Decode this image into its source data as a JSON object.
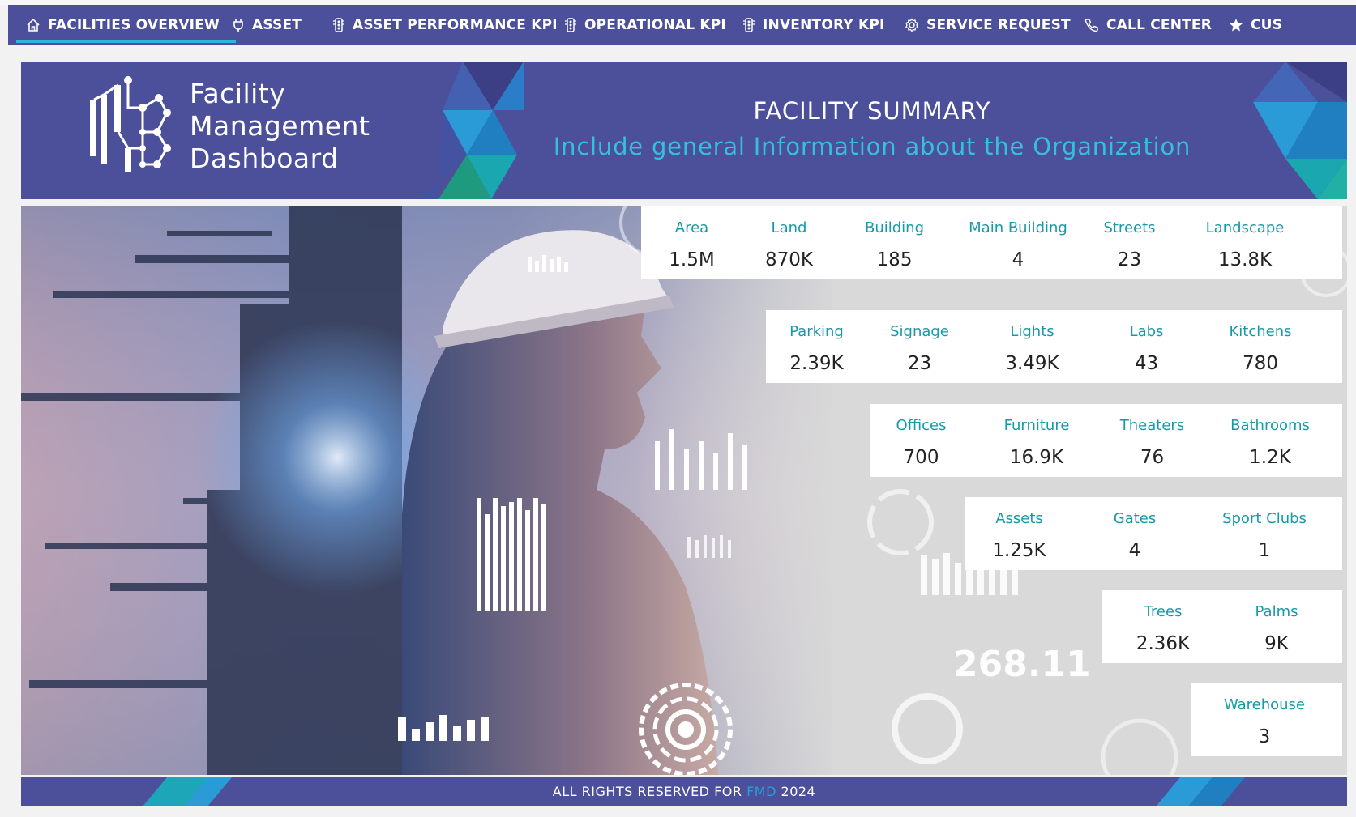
{
  "nav": {
    "items": [
      {
        "label": "FACILITIES OVERVIEW",
        "icon": "home-icon",
        "active": true
      },
      {
        "label": "ASSET",
        "icon": "plug-icon"
      },
      {
        "label": "ASSET PERFORMANCE KPI",
        "icon": "traffic-light-icon"
      },
      {
        "label": "OPERATIONAL KPI",
        "icon": "traffic-light-icon"
      },
      {
        "label": "INVENTORY KPI",
        "icon": "traffic-light-icon"
      },
      {
        "label": "SERVICE REQUEST",
        "icon": "gear-icon"
      },
      {
        "label": "CALL CENTER",
        "icon": "phone-icon"
      },
      {
        "label": "CUS",
        "icon": "star-icon"
      }
    ]
  },
  "banner": {
    "brand_line1": "Facility",
    "brand_line2": "Management",
    "brand_line3": "Dashboard",
    "title": "FACILITY SUMMARY",
    "subtitle": "Include general Information about the Organization"
  },
  "stats": {
    "row1": [
      {
        "label": "Area",
        "value": "1.5M"
      },
      {
        "label": "Land",
        "value": "870K"
      },
      {
        "label": "Building",
        "value": "185"
      },
      {
        "label": "Main Building",
        "value": "4"
      },
      {
        "label": "Streets",
        "value": "23"
      },
      {
        "label": "Landscape",
        "value": "13.8K"
      }
    ],
    "row2": [
      {
        "label": "Parking",
        "value": "2.39K"
      },
      {
        "label": "Signage",
        "value": "23"
      },
      {
        "label": "Lights",
        "value": "3.49K"
      },
      {
        "label": "Labs",
        "value": "43"
      },
      {
        "label": "Kitchens",
        "value": "780"
      }
    ],
    "row3": [
      {
        "label": "Offices",
        "value": "700"
      },
      {
        "label": "Furniture",
        "value": "16.9K"
      },
      {
        "label": "Theaters",
        "value": "76"
      },
      {
        "label": "Bathrooms",
        "value": "1.2K"
      }
    ],
    "row4": [
      {
        "label": "Assets",
        "value": "1.25K"
      },
      {
        "label": "Gates",
        "value": "4"
      },
      {
        "label": "Sport Clubs",
        "value": "1"
      }
    ],
    "row5": [
      {
        "label": "Trees",
        "value": "2.36K"
      },
      {
        "label": "Palms",
        "value": "9K"
      }
    ],
    "row6": [
      {
        "label": "Warehouse",
        "value": "3"
      }
    ]
  },
  "hero": {
    "overlay_number": "268.11"
  },
  "footer": {
    "prefix": "ALL RIGHTS RESERVED FOR",
    "brand": "FMD",
    "year": "2024"
  },
  "colors": {
    "primary": "#4c4f9a",
    "accent": "#2eb6d6",
    "label": "#179aa8"
  }
}
